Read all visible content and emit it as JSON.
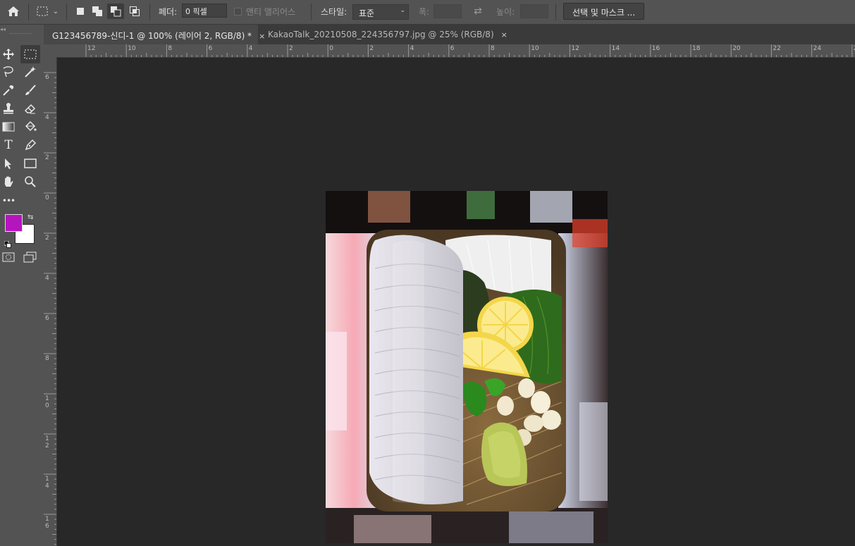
{
  "options_bar": {
    "home_icon": "home-icon",
    "marquee_icon": "rect-marquee-icon",
    "feather_label": "페더:",
    "feather_value": "0 픽셀",
    "antialias_label": "앤티 앨리어스",
    "style_label": "스타일:",
    "style_value": "표준",
    "width_label": "폭:",
    "height_label": "높이:",
    "select_mask_label": "선택 및 마스크 ..."
  },
  "tabs": [
    {
      "title": "G123456789-신디-1 @ 100% (레이어 2, RGB/8) *",
      "close": "×"
    },
    {
      "title": "KakaoTalk_20210508_224356797.jpg @ 25% (RGB/8)",
      "close": "×"
    }
  ],
  "colors": {
    "foreground": "#b515bd",
    "background": "#ffffff"
  },
  "ruler_h": [
    "12",
    "10",
    "8",
    "6",
    "4",
    "2",
    "0",
    "2",
    "4",
    "6",
    "8",
    "10",
    "12",
    "14",
    "16",
    "18",
    "20",
    "22",
    "24",
    "26"
  ],
  "ruler_v": [
    "6",
    "4",
    "2",
    "0",
    "2",
    "4",
    "6",
    "8",
    "10",
    "12",
    "14",
    "16"
  ],
  "tools": {
    "more_label": "•••"
  }
}
